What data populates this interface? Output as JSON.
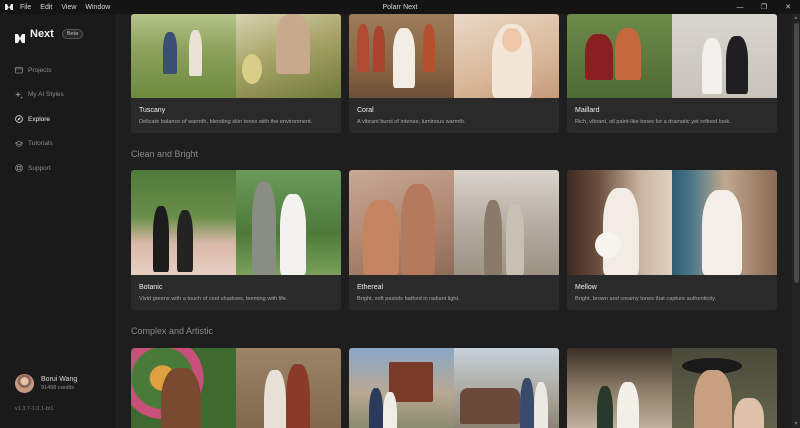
{
  "app": {
    "window_title": "Polarr Next",
    "menu": [
      "File",
      "Edit",
      "View",
      "Window"
    ],
    "window_controls": [
      "minimize-icon",
      "maximize-icon",
      "close-icon"
    ]
  },
  "sidebar": {
    "brand": "Next",
    "badge": "Beta",
    "items": [
      {
        "label": "Projects",
        "icon": "folder-icon",
        "active": false
      },
      {
        "label": "My AI Styles",
        "icon": "sparkle-icon",
        "active": false
      },
      {
        "label": "Explore",
        "icon": "compass-icon",
        "active": true
      },
      {
        "label": "Tutorials",
        "icon": "graduation-cap-icon",
        "active": false
      },
      {
        "label": "Support",
        "icon": "lifebuoy-icon",
        "active": false
      }
    ],
    "user": {
      "name": "Borui Wang",
      "credits": "91498 credits"
    },
    "version": "v1.3.7-1.0.1-bt1"
  },
  "sections": [
    {
      "title": "",
      "cards": [
        {
          "title": "Tuscany",
          "description": "Delicate balance of warmth, blending skin tones with the environment."
        },
        {
          "title": "Coral",
          "description": "A vibrant burst of intense, luminous warmth."
        },
        {
          "title": "Maillard",
          "description": "Rich, vibrant, oil paint-like tones for a dramatic yet refined look."
        }
      ]
    },
    {
      "title": "Clean and Bright",
      "cards": [
        {
          "title": "Botanic",
          "description": "Vivid greens with a touch of cool shadows, teeming with life."
        },
        {
          "title": "Ethereal",
          "description": "Bright, soft pastels bathed in radiant light."
        },
        {
          "title": "Mellow",
          "description": "Bright, brown and creamy tones that capture authenticity."
        }
      ]
    },
    {
      "title": "Complex and Artistic",
      "cards": [
        {
          "title": "",
          "description": ""
        },
        {
          "title": "",
          "description": ""
        },
        {
          "title": "",
          "description": ""
        }
      ]
    }
  ],
  "colors": {
    "background": "#1e1e1e",
    "sidebar": "#1a1a1a",
    "card": "#2a2a2a",
    "titlebar": "#141414"
  }
}
